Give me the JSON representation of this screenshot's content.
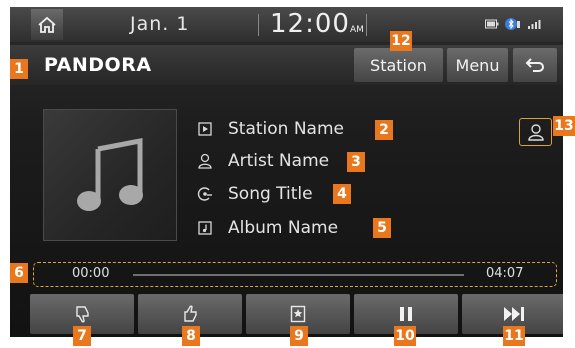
{
  "status_bar": {
    "date": "Jan.  1",
    "time": "12:00",
    "ampm": "AM",
    "icons": [
      "home-icon",
      "battery-icon",
      "bluetooth-icon",
      "signal-icon"
    ]
  },
  "header": {
    "title": "PANDORA",
    "station_button": "Station",
    "menu_button": "Menu",
    "back_icon": "back-arrow-icon"
  },
  "track_info": {
    "station": "Station Name",
    "artist": "Artist Name",
    "song": "Song Title",
    "album": "Album Name"
  },
  "progress": {
    "current_time": "00:00",
    "total_time": "04:07",
    "fraction": 0
  },
  "controls": [
    "thumbs-down-icon",
    "thumbs-up-icon",
    "bookmark-icon",
    "pause-icon",
    "skip-next-icon"
  ],
  "callouts": {
    "n1": "1",
    "n2": "2",
    "n3": "3",
    "n4": "4",
    "n5": "5",
    "n6": "6",
    "n7": "7",
    "n8": "8",
    "n9": "9",
    "n10": "10",
    "n11": "11",
    "n12": "12",
    "n13": "13"
  },
  "colors": {
    "callout": "#e8771e",
    "highlight_outline": "#e0a63a",
    "background": "#1c1c1c",
    "button": "#555555"
  }
}
